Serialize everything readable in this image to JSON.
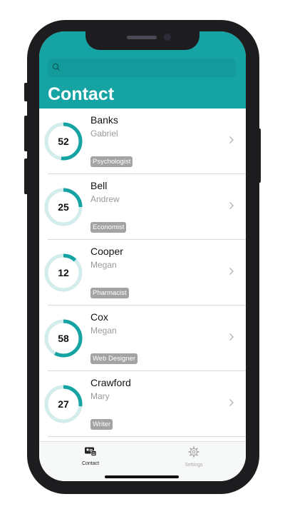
{
  "header": {
    "title": "Contact",
    "search_placeholder": "",
    "background": "#16a3a3"
  },
  "contacts": [
    {
      "last": "Banks",
      "first": "Gabriel",
      "tag": "Psychologist",
      "score": "52",
      "percent": 0.52
    },
    {
      "last": "Bell",
      "first": "Andrew",
      "tag": "Economist",
      "score": "25",
      "percent": 0.25
    },
    {
      "last": "Cooper",
      "first": "Megan",
      "tag": "Pharmacist",
      "score": "12",
      "percent": 0.12
    },
    {
      "last": "Cox",
      "first": "Megan",
      "tag": "Web Designer",
      "score": "58",
      "percent": 0.58
    },
    {
      "last": "Crawford",
      "first": "Mary",
      "tag": "Writer",
      "score": "27",
      "percent": 0.27
    }
  ],
  "tabs": [
    {
      "label": "Contact",
      "icon": "contact-card-icon",
      "active": true
    },
    {
      "label": "Settings",
      "icon": "gear-icon",
      "active": false
    }
  ],
  "colors": {
    "accent": "#16a3a3",
    "ring_track": "#d3ecec",
    "tag": "#a3a3a3"
  }
}
